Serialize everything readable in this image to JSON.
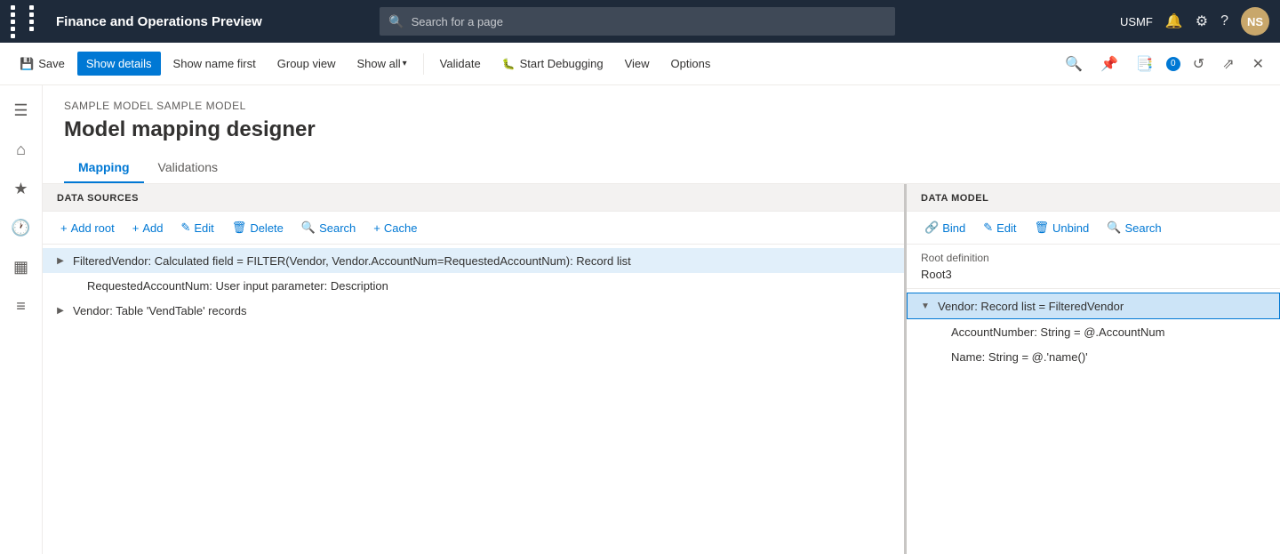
{
  "app": {
    "title": "Finance and Operations Preview",
    "search_placeholder": "Search for a page",
    "nav_right": {
      "usmf": "USMF",
      "avatar_initials": "NS"
    }
  },
  "toolbar": {
    "save_label": "Save",
    "show_details_label": "Show details",
    "show_name_first_label": "Show name first",
    "group_view_label": "Group view",
    "show_all_label": "Show all",
    "validate_label": "Validate",
    "start_debugging_label": "Start Debugging",
    "view_label": "View",
    "options_label": "Options"
  },
  "breadcrumb": "SAMPLE MODEL SAMPLE MODEL",
  "page_title": "Model mapping designer",
  "tabs": [
    {
      "label": "Mapping",
      "active": true
    },
    {
      "label": "Validations",
      "active": false
    }
  ],
  "data_sources_panel": {
    "header": "DATA SOURCES",
    "buttons": [
      {
        "icon": "+",
        "label": "Add root"
      },
      {
        "icon": "+",
        "label": "Add"
      },
      {
        "icon": "✎",
        "label": "Edit"
      },
      {
        "icon": "🗑",
        "label": "Delete"
      },
      {
        "icon": "🔍",
        "label": "Search"
      },
      {
        "icon": "+",
        "label": "Cache"
      }
    ],
    "tree": [
      {
        "id": "filtered-vendor",
        "expanded": false,
        "indent": 0,
        "label": "FilteredVendor: Calculated field = FILTER(Vendor, Vendor.AccountNum=RequestedAccountNum): Record list"
      },
      {
        "id": "requested-account-num",
        "expanded": null,
        "indent": 1,
        "label": "RequestedAccountNum: User input parameter: Description"
      },
      {
        "id": "vendor-table",
        "expanded": false,
        "indent": 0,
        "label": "Vendor: Table 'VendTable' records"
      }
    ]
  },
  "data_model_panel": {
    "header": "DATA MODEL",
    "buttons": [
      {
        "icon": "🔗",
        "label": "Bind"
      },
      {
        "icon": "✎",
        "label": "Edit"
      },
      {
        "icon": "🗑",
        "label": "Unbind"
      },
      {
        "icon": "🔍",
        "label": "Search"
      }
    ],
    "root_definition_label": "Root definition",
    "root_definition_value": "Root3",
    "tree": [
      {
        "id": "vendor-record",
        "expanded": true,
        "indent": 0,
        "selected": true,
        "label": "Vendor: Record list = FilteredVendor"
      },
      {
        "id": "account-number",
        "expanded": null,
        "indent": 1,
        "selected": false,
        "label": "AccountNumber: String = @.AccountNum"
      },
      {
        "id": "name-string",
        "expanded": null,
        "indent": 1,
        "selected": false,
        "label": "Name: String = @.'name()'"
      }
    ]
  },
  "sidebar": {
    "items": [
      {
        "icon": "☰",
        "label": "Menu",
        "active": false
      },
      {
        "icon": "⌂",
        "label": "Home",
        "active": false
      },
      {
        "icon": "★",
        "label": "Favorites",
        "active": false
      },
      {
        "icon": "🕐",
        "label": "Recent",
        "active": false
      },
      {
        "icon": "📋",
        "label": "Workspaces",
        "active": false
      },
      {
        "icon": "≡",
        "label": "Modules",
        "active": false
      }
    ]
  }
}
